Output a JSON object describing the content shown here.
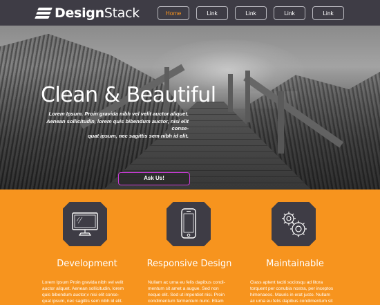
{
  "brand": {
    "name_bold": "Design",
    "name_rest": "Stack"
  },
  "nav": {
    "items": [
      {
        "label": "Home",
        "active": true
      },
      {
        "label": "Link",
        "active": false
      },
      {
        "label": "Link",
        "active": false
      },
      {
        "label": "Link",
        "active": false
      },
      {
        "label": "Link",
        "active": false
      }
    ]
  },
  "hero": {
    "title": "Clean & Beautiful",
    "lines": [
      "Lorem Ipsum. Proin gravida nibh vel velit auctor aliquet.",
      "Aenean sollicitudin, lorem quis bibendum auctor, nisi elit conse-",
      "quat ipsum, nec sagittis sem nibh id elit."
    ],
    "cta_label": "Ask Us!"
  },
  "features": [
    {
      "icon": "monitor-icon",
      "title": "Development",
      "lines": [
        "Lorem Ipsum Proin gravida nibh vel velit",
        "auctor aliquet. Aenean sollicitudin, lorem",
        "quis bibendum auctor,v nisi elit conse-",
        "quat ipsum, nec sagittis sem nibh id elit."
      ]
    },
    {
      "icon": "smartphone-icon",
      "title": "Responsive Design",
      "lines": [
        "Nullam ac urna eu felis dapibus condi-",
        "mentum sit amet a augue. Sed non",
        "neque elit. Sed ut imperdiet nisi. Proin",
        "condimentum fermentum nunc. Etiam"
      ]
    },
    {
      "icon": "gears-icon",
      "title": "Maintainable",
      "lines": [
        "Class aptent taciti sociosqu ad litora",
        "torquent per conubia nostra, per inceptos",
        "himenaeos. Mauris in erat justo. Nullam",
        "ac urna eu felis dapibus condimentum sit"
      ]
    }
  ],
  "colors": {
    "header_bg": "#3e3c45",
    "accent_orange": "#f7941e",
    "cta_border": "#c83ad6"
  }
}
